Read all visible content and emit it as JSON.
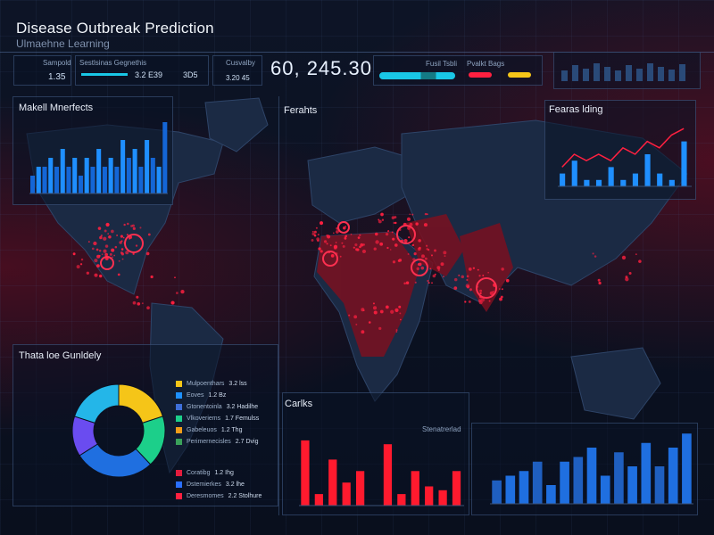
{
  "header": {
    "title": "Disease Outbreak Prediction",
    "subtitle": "Ulmaehne Learning",
    "big_number": "60, 245.30",
    "stats": [
      {
        "label": "Sampold",
        "value": "1.35"
      },
      {
        "label": "Sestlsinas Gegnethis",
        "value": "3.2 E39"
      },
      {
        "label": "",
        "value": "3D5"
      },
      {
        "label": "Cusvalby",
        "value": "3.20 45"
      }
    ],
    "progress_labels": [
      "Fusil Tsbli",
      "Pvalkt Bags"
    ]
  },
  "panels": {
    "top_left": "Makell Mnerfects",
    "map": "Ferahts",
    "top_right": "Fearas lding",
    "donut": "Thata loe Gunldely",
    "bottom_mid": "Carlks",
    "bottom_mid_sub": "Stenatrerlad"
  },
  "legend": [
    {
      "label": "Mulpoenthars",
      "value": "3.2 lss",
      "color": "#f5c518"
    },
    {
      "label": "Eoves",
      "value": "1.2 Bz",
      "color": "#1e90ff"
    },
    {
      "label": "Gtonentoinla",
      "value": "3.2 Hadilhe",
      "color": "#3f6fd8"
    },
    {
      "label": "Vlkoveriems",
      "value": "1.7 Femulss",
      "color": "#1ccf8a"
    },
    {
      "label": "Gabeleuos",
      "value": "1.2 Thg",
      "color": "#f29d1a"
    },
    {
      "label": "Perimernecisles",
      "value": "2.7 Dvig",
      "color": "#3aa15a"
    },
    {
      "label": "Coratibg",
      "value": "1.2 Ihg",
      "color": "#e31c3d"
    },
    {
      "label": "Dstemierkes",
      "value": "3.2 lhe",
      "color": "#2a6fff"
    },
    {
      "label": "Deresmomes",
      "value": "2.2 Stolhure",
      "color": "#ff2040"
    }
  ],
  "colors": {
    "accent_red": "#ff2040",
    "accent_blue": "#1e88ff",
    "accent_cyan": "#19c7e6",
    "background": "#0b1120"
  },
  "chart_data": [
    {
      "type": "bar",
      "title": "Makell Mnerfects",
      "values": [
        2,
        3,
        3,
        4,
        3,
        5,
        3,
        4,
        2,
        4,
        3,
        5,
        3,
        4,
        3,
        6,
        4,
        5,
        3,
        6,
        4,
        3,
        8
      ],
      "ylim": [
        0,
        8
      ]
    },
    {
      "type": "bar",
      "title": "Fearas lding",
      "series": [
        {
          "values": [
            2,
            4,
            1,
            1,
            3,
            1,
            2,
            5,
            2,
            1,
            7
          ]
        },
        {
          "type": "line",
          "values": [
            3,
            5,
            4,
            5,
            4,
            6,
            5,
            7,
            6,
            8,
            9
          ]
        }
      ],
      "ylim": [
        0,
        10
      ]
    },
    {
      "type": "pie",
      "title": "Thata loe Gunldely",
      "values": [
        20,
        18,
        28,
        14,
        20
      ],
      "colors": [
        "#f5c518",
        "#1ccf8a",
        "#1f6fe0",
        "#6a4cf0",
        "#24b6e8"
      ]
    },
    {
      "type": "bar",
      "title": "Carlks",
      "values": [
        8.5,
        1.5,
        6,
        3,
        4.5,
        0,
        8,
        1.5,
        4.5,
        2.5,
        2,
        4.5
      ],
      "ylim": [
        0,
        10
      ]
    },
    {
      "type": "bar",
      "values": [
        2.5,
        3,
        3.5,
        4.5,
        2,
        4.5,
        5,
        6,
        3,
        5.5,
        4,
        6.5,
        4,
        6,
        7.5
      ],
      "ylim": [
        0,
        8
      ]
    }
  ]
}
